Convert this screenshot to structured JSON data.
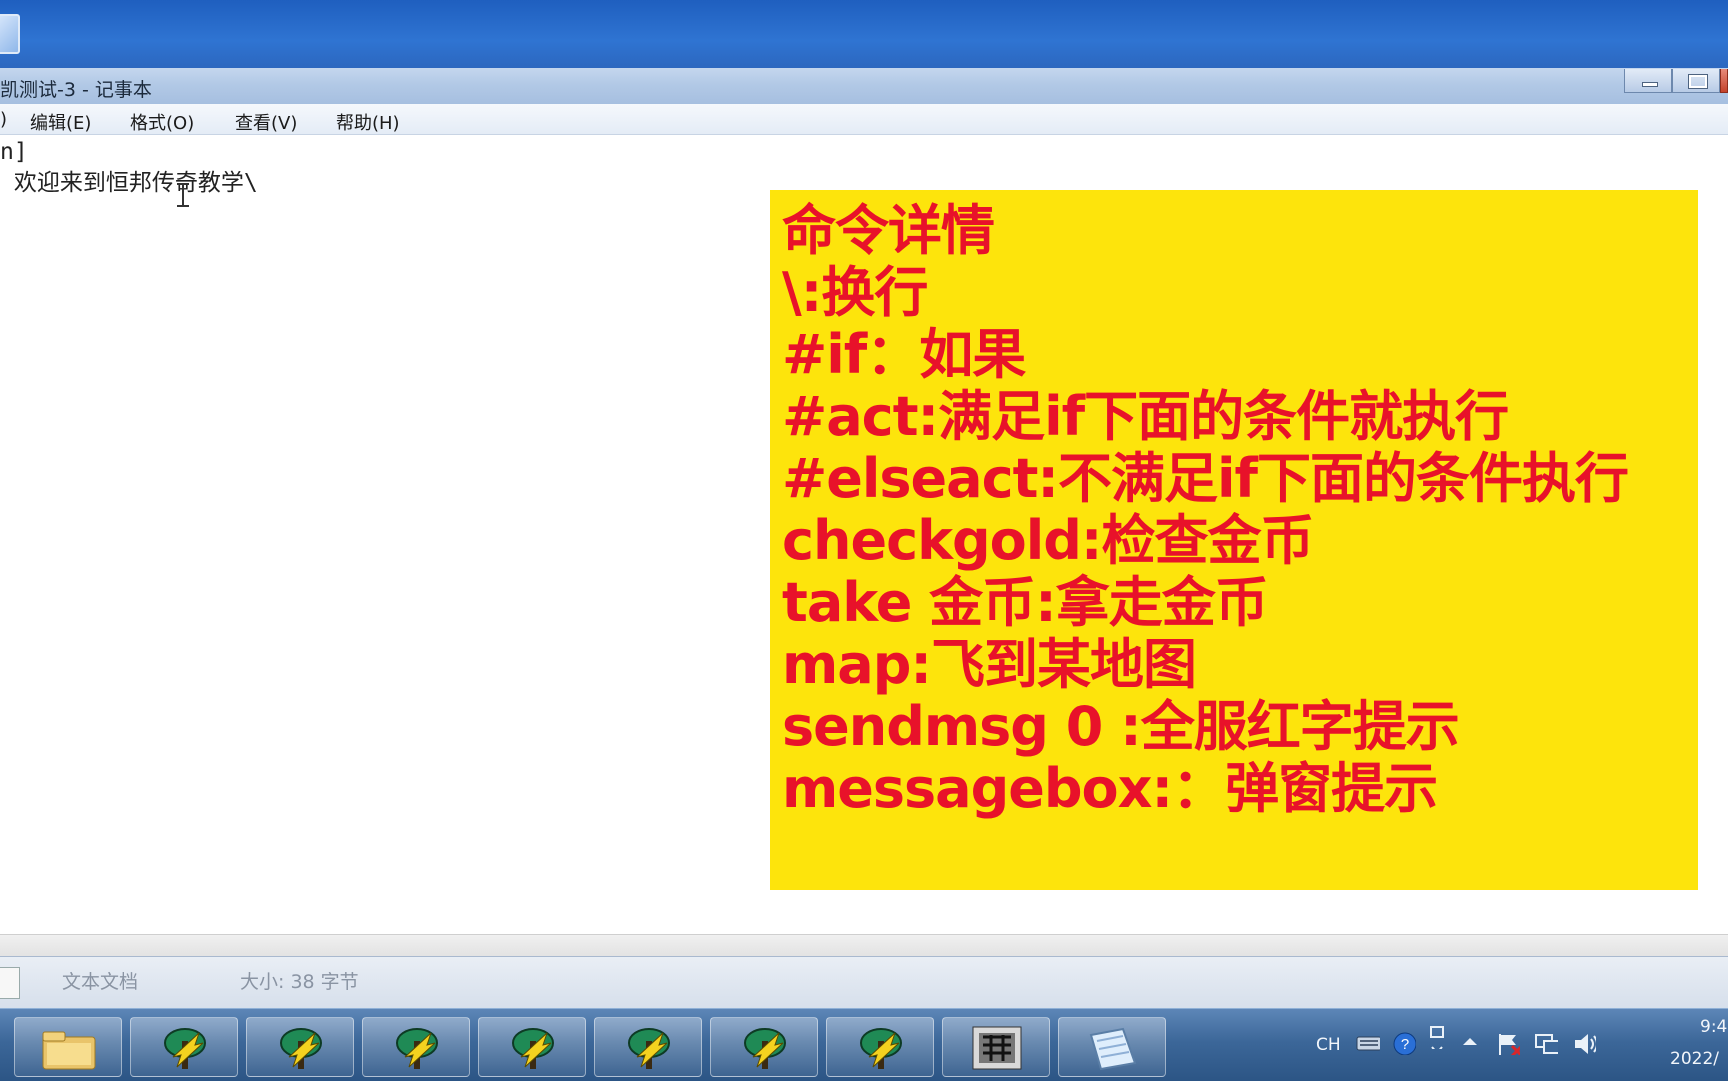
{
  "window": {
    "title": "凯测试-3 - 记事本",
    "controls": {
      "minimize": "minimize",
      "maximize": "maximize",
      "close": "close"
    }
  },
  "menu": [
    {
      "label": ")"
    },
    {
      "label": "编辑(E)"
    },
    {
      "label": "格式(O)"
    },
    {
      "label": "查看(V)"
    },
    {
      "label": "帮助(H)"
    }
  ],
  "editor": {
    "lines": [
      "n]",
      " 欢迎来到恒邦传奇教学\\"
    ]
  },
  "overlay": {
    "background": "#fde40c",
    "text_color": "#e8122a",
    "lines": [
      "命令详情",
      "\\:换行",
      "#if：如果",
      "#act:满足if下面的条件就执行",
      "#elseact:不满足if下面的条件执行",
      "checkgold:检查金币",
      "take 金币:拿走金币",
      "map:飞到某地图",
      "sendmsg 0 :全服红字提示",
      "messagebox:：弹窗提示"
    ]
  },
  "statusbar": {
    "type": "文本文档",
    "size": "大小: 38 字节"
  },
  "taskbar": {
    "buttons": [
      {
        "name": "explorer",
        "icon": "folder-icon"
      },
      {
        "name": "app1",
        "icon": "game-server-icon"
      },
      {
        "name": "app2",
        "icon": "game-server-icon"
      },
      {
        "name": "app3",
        "icon": "game-server-icon"
      },
      {
        "name": "app4",
        "icon": "game-server-icon"
      },
      {
        "name": "app5",
        "icon": "game-server-icon"
      },
      {
        "name": "app6",
        "icon": "game-server-icon"
      },
      {
        "name": "app7",
        "icon": "game-server-icon"
      },
      {
        "name": "app8",
        "icon": "dragon-icon"
      },
      {
        "name": "notepad",
        "icon": "notepad-icon"
      }
    ],
    "tray": {
      "lang": "CH",
      "clock_time": "9:4",
      "clock_date": "2022/"
    }
  }
}
